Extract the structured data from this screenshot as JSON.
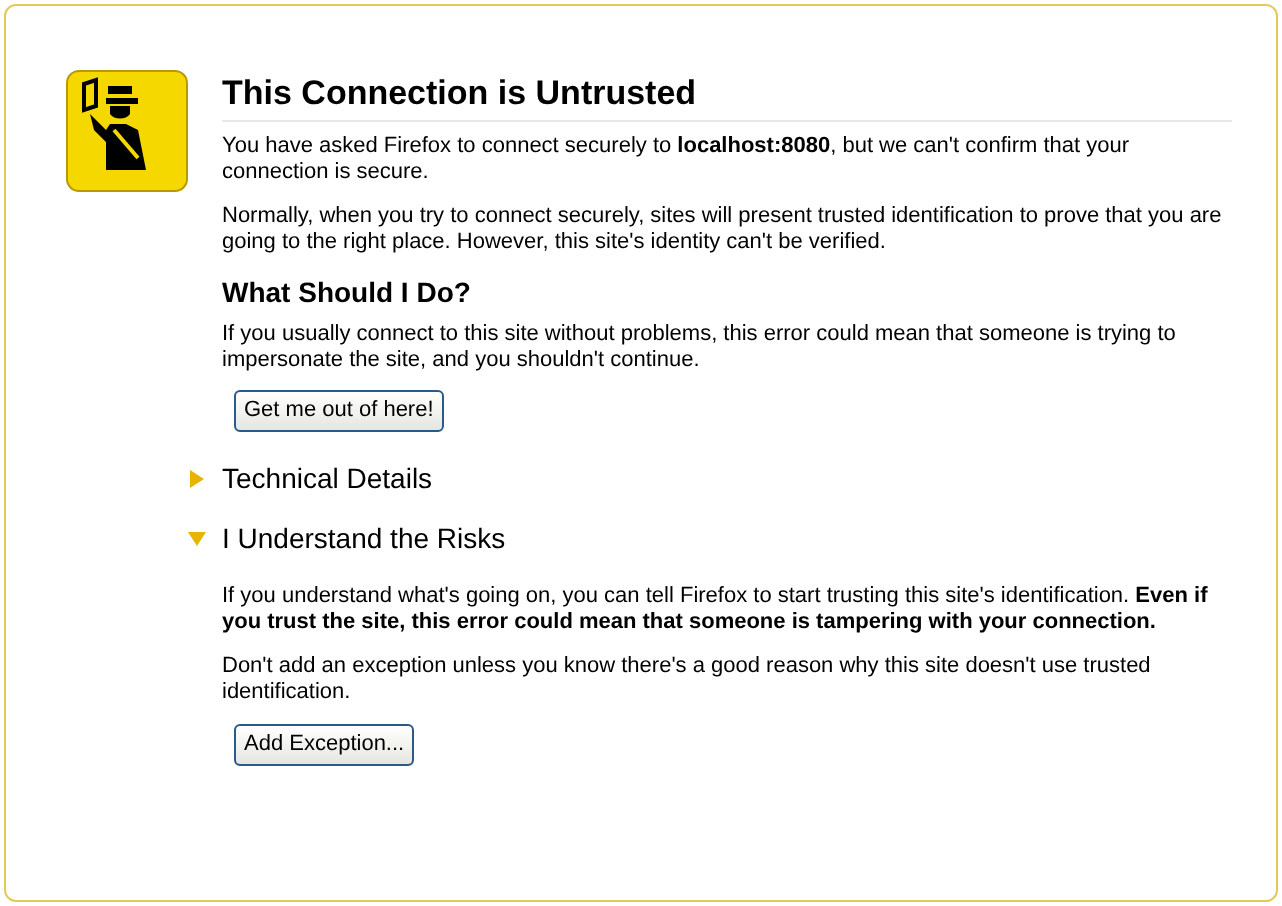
{
  "title": "This Connection is Untrusted",
  "intro": [
    "You have asked Firefox to connect securely to **localhost:8080**, but we can't confirm that your connection is secure.",
    "Normally, when you try to connect securely, sites will present trusted identification to prove that you are going to the right place. However, this site's identity can't be verified."
  ],
  "what_to_do": {
    "heading": "What Should I Do?",
    "text": "If you usually connect to this site without problems, this error could mean that someone is trying to impersonate the site, and you shouldn't continue.",
    "button": "Get me out of here!"
  },
  "expanders": [
    {
      "heading": "Technical Details",
      "expanded": false
    },
    {
      "heading": "I Understand the Risks",
      "expanded": true,
      "paragraphs": [
        "If you understand what's going on, you can tell Firefox to start trusting this site's identification. **Even if you trust the site, this error could mean that someone is tampering with your connection.**",
        "Don't add an exception unless you know there's a good reason why this site doesn't use trusted identification."
      ],
      "button": "Add Exception..."
    }
  ]
}
